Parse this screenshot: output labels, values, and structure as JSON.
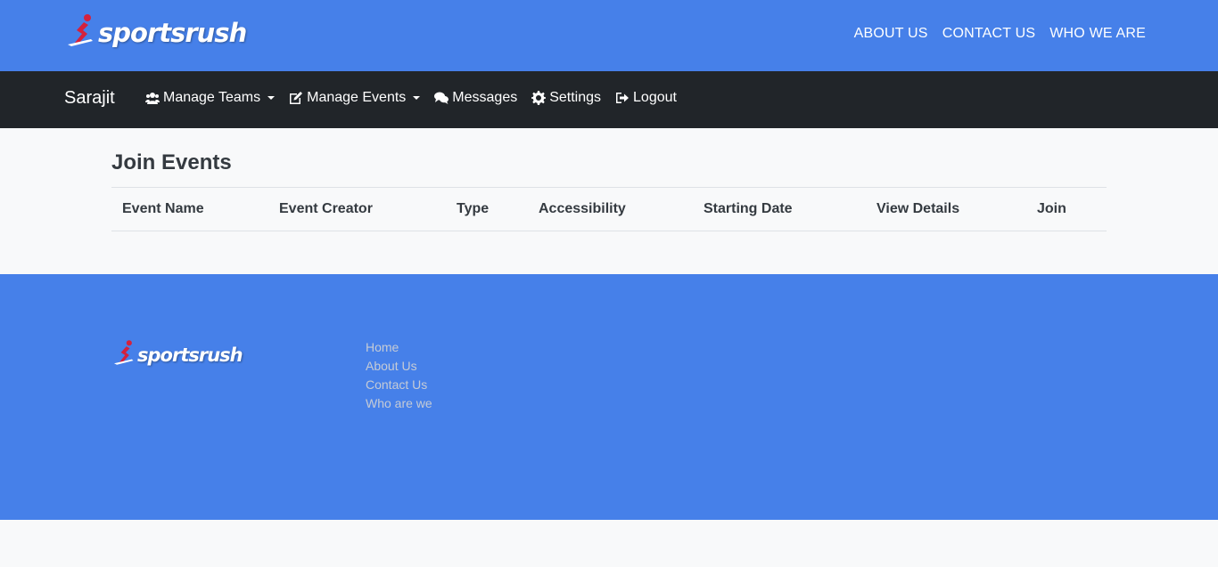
{
  "brand": {
    "logo_text": "sportsrush"
  },
  "top_nav": {
    "links": [
      "ABOUT US",
      "CONTACT US",
      "WHO WE ARE"
    ]
  },
  "navbar": {
    "user": "Sarajit",
    "items": [
      {
        "label": "Manage Teams",
        "icon": "users-icon",
        "dropdown": true
      },
      {
        "label": "Manage Events",
        "icon": "edit-icon",
        "dropdown": true
      },
      {
        "label": "Messages",
        "icon": "comments-icon",
        "dropdown": false
      },
      {
        "label": "Settings",
        "icon": "gear-icon",
        "dropdown": false
      },
      {
        "label": "Logout",
        "icon": "sign-out-icon",
        "dropdown": false
      }
    ]
  },
  "main": {
    "title": "Join Events",
    "columns": [
      "Event Name",
      "Event Creator",
      "Type",
      "Accessibility",
      "Starting Date",
      "View Details",
      "Join"
    ],
    "rows": []
  },
  "footer": {
    "links": [
      "Home",
      "About Us",
      "Contact Us",
      "Who are we"
    ]
  },
  "colors": {
    "primary": "#4680e9",
    "navbar": "#212529",
    "logo_accent": "#d4213d"
  }
}
